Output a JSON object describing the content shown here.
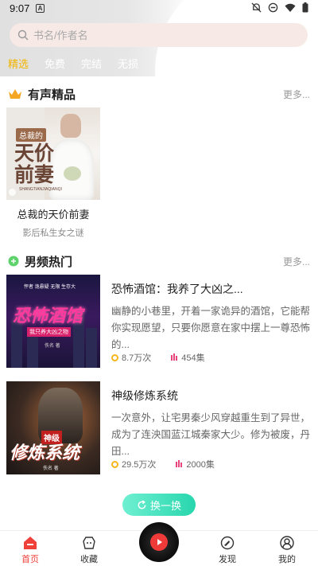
{
  "status": {
    "time": "9:07",
    "notification_badge": "A"
  },
  "search": {
    "placeholder": "书名/作者名"
  },
  "tabs": [
    {
      "label": "精选",
      "active": true
    },
    {
      "label": "免费",
      "active": false
    },
    {
      "label": "完结",
      "active": false
    },
    {
      "label": "无损",
      "active": false
    }
  ],
  "audio_section": {
    "title": "有声精品",
    "more": "更多...",
    "book": {
      "cover_badge": "总裁的",
      "cover_art_title": "天价前妻",
      "cover_pinyin": "SHANGTIANJIAQIANQI",
      "title": "总裁的天价前妻",
      "subtitle": "影后私生女之谜"
    }
  },
  "male_section": {
    "title": "男频热门",
    "more": "更多...",
    "books": [
      {
        "title": "恐怖酒馆：我养了大凶之...",
        "desc": "幽静的小巷里，开着一家诡异的酒馆，它能帮你实现愿望，只要你愿意在家中摆上一尊恐怖的...",
        "plays": "8.7万次",
        "episodes": "454集",
        "cover_tags": "怦者 诡悬疑 无限 生存大",
        "cover_art": "恐怖酒馆",
        "cover_ribbon": "我只养大凶之物",
        "cover_author": "佚名 著"
      },
      {
        "title": "神级修炼系统",
        "desc": "一次意外，让宅男秦少风穿越重生到了异世，成为了连泱国蓝江城秦家大少。修为被废，丹田...",
        "plays": "29.5万次",
        "episodes": "2000集",
        "cover_red": "神级",
        "cover_art": "修炼系统",
        "cover_author": "佚名 著"
      }
    ]
  },
  "refresh_label": "换一换",
  "bottom_nav": [
    {
      "label": "首页",
      "icon": "home-icon",
      "active": true
    },
    {
      "label": "收藏",
      "icon": "collect-icon",
      "active": false
    },
    {
      "label": "发现",
      "icon": "discover-icon",
      "active": false
    },
    {
      "label": "我的",
      "icon": "profile-icon",
      "active": false
    }
  ],
  "colors": {
    "accent": "#f0403a",
    "tab_active": "#f2b400",
    "refresh": "#28d6ad"
  }
}
